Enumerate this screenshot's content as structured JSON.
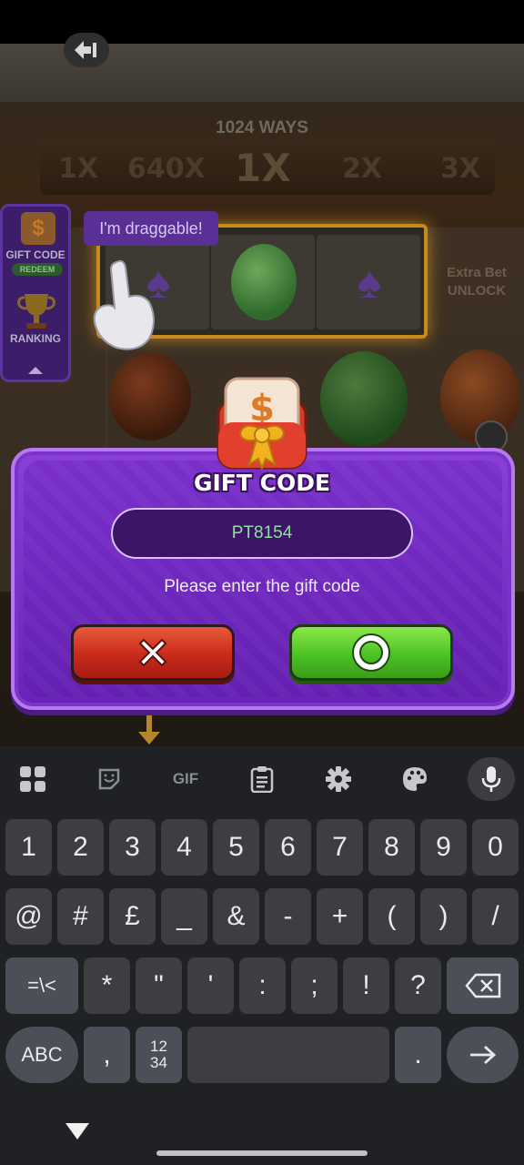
{
  "game": {
    "ways_label": "1024 WAYS",
    "multipliers": [
      "1X",
      "640X",
      "1X",
      "2X",
      "3X"
    ],
    "draggable_tip": "I'm draggable!",
    "extra_bet": "Extra Bet",
    "extra_bet_unlock": "UNLOCK",
    "side_panel": {
      "gift_code_label": "GIFT CODE",
      "redeem_label": "REDEEM",
      "ranking_label": "RANKING"
    }
  },
  "dialog": {
    "title": "GIFT CODE",
    "input_value": "PT8154",
    "prompt": "Please enter the gift code",
    "accent_green": "#4cc224",
    "accent_red": "#c92a1a",
    "accent_purple": "#7a2fcb"
  },
  "keyboard": {
    "toolbar_icons": [
      "apps-grid-icon",
      "sticker-icon",
      "gif-icon",
      "clipboard-icon",
      "settings-gear-icon",
      "palette-icon",
      "microphone-icon"
    ],
    "gif_label": "GIF",
    "row1": [
      "1",
      "2",
      "3",
      "4",
      "5",
      "6",
      "7",
      "8",
      "9",
      "0"
    ],
    "row2": [
      "@",
      "#",
      "£",
      "_",
      "&",
      "-",
      "+",
      "(",
      ")",
      "/"
    ],
    "row3_mode": "=\\<",
    "row3": [
      "*",
      "\"",
      "'",
      ":",
      ";",
      "!",
      "?"
    ],
    "abc_label": "ABC",
    "comma": ",",
    "numpad_label_top": "12",
    "numpad_label_bottom": "34",
    "period": "."
  }
}
